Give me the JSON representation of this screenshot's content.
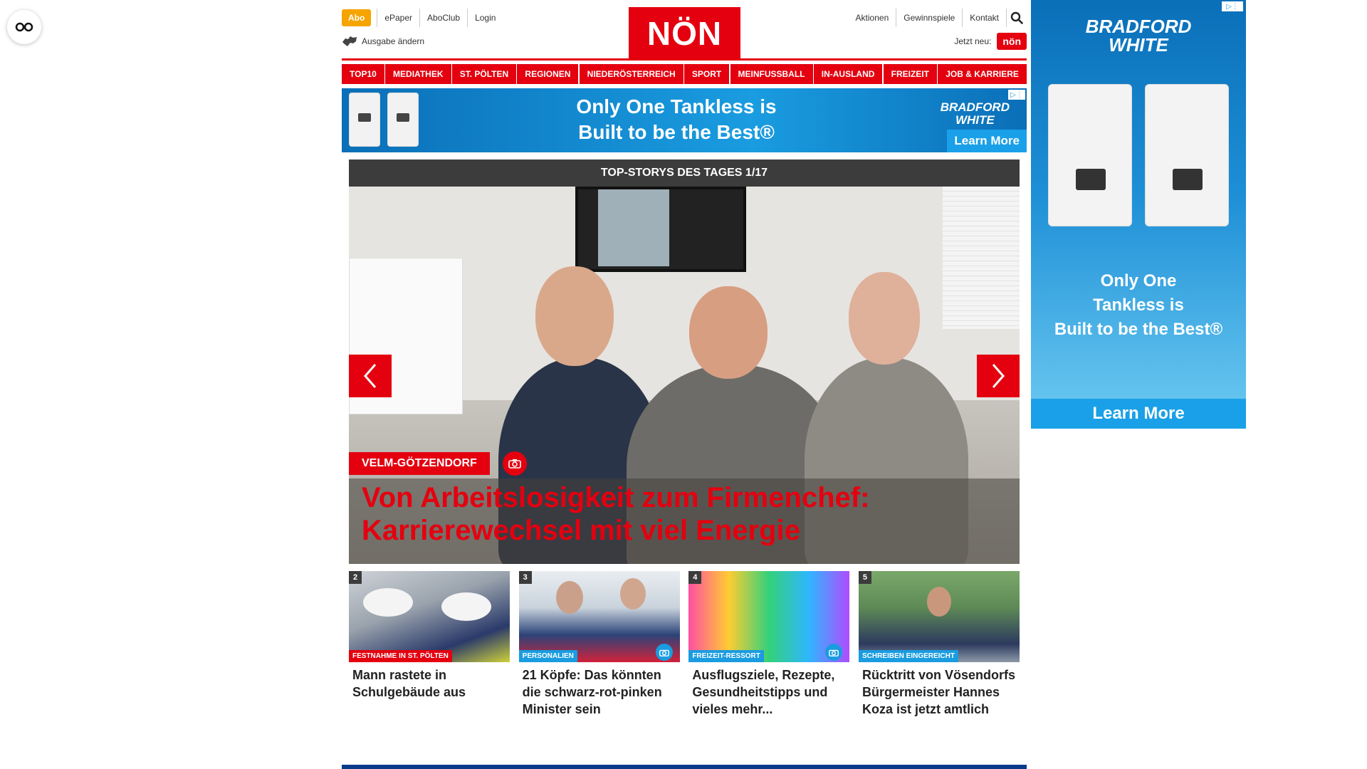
{
  "header": {
    "abo_label": "Abo",
    "top_links": [
      "ePaper",
      "AboClub",
      "Login"
    ],
    "edition_label": "Ausgabe ändern",
    "logo_text": "NÖN",
    "right_links": [
      "Aktionen",
      "Gewinnspiele",
      "Kontakt"
    ],
    "jetzt_label": "Jetzt neu:",
    "jetzt_badge": "nön"
  },
  "nav": {
    "items": [
      "TOP10",
      "MEDIATHEK",
      "ST. PÖLTEN",
      "REGIONEN",
      "NIEDERÖSTERREICH",
      "SPORT",
      "MEINFUSSBALL",
      "IN-AUSLAND",
      "FREIZEIT",
      "JOB & KARRIERE"
    ]
  },
  "ad_banner": {
    "line1": "Only One Tankless is",
    "line2": "Built to be the Best®",
    "brand_line1": "BRADFORD",
    "brand_line2": "WHITE",
    "cta": "Learn More"
  },
  "top_stories": {
    "heading": "TOP-STORYS DES TAGES 1/17",
    "hero": {
      "tag": "VELM-GÖTZENDORF",
      "title": "Von Arbeitslosigkeit zum Firmenchef: Karrierewechsel mit viel Energie"
    },
    "cards": [
      {
        "num": "2",
        "label": "FESTNAHME IN ST. PÖLTEN",
        "title": "Mann rastete in Schulgebäude aus"
      },
      {
        "num": "3",
        "label": "PERSONALIEN",
        "title": "21 Köpfe: Das könnten die schwarz-rot-pinken Minister sein"
      },
      {
        "num": "4",
        "label": "FREIZEIT-RESSORT",
        "title": "Ausflugsziele, Rezepte, Gesundheitstipps und vieles mehr..."
      },
      {
        "num": "5",
        "label": "SCHREIBEN EINGEREICHT",
        "title": "Rücktritt von Vösendorfs Bürgermeister Hannes Koza ist jetzt amtlich"
      }
    ]
  },
  "sky_ad": {
    "brand_line1": "BRADFORD",
    "brand_line2": "WHITE",
    "text_line1": "Only One",
    "text_line2": "Tankless is",
    "text_line3": "Built to be the Best®",
    "cta": "Learn More"
  },
  "colors": {
    "brand_red": "#e4000f",
    "abo_orange": "#f5a400",
    "dark_header": "#3c3c3c",
    "ad_blue": "#1a9ce0"
  },
  "icons": [
    "accessibility-icon",
    "austria-map-icon",
    "search-icon",
    "chevron-left-icon",
    "chevron-right-icon",
    "camera-icon"
  ]
}
